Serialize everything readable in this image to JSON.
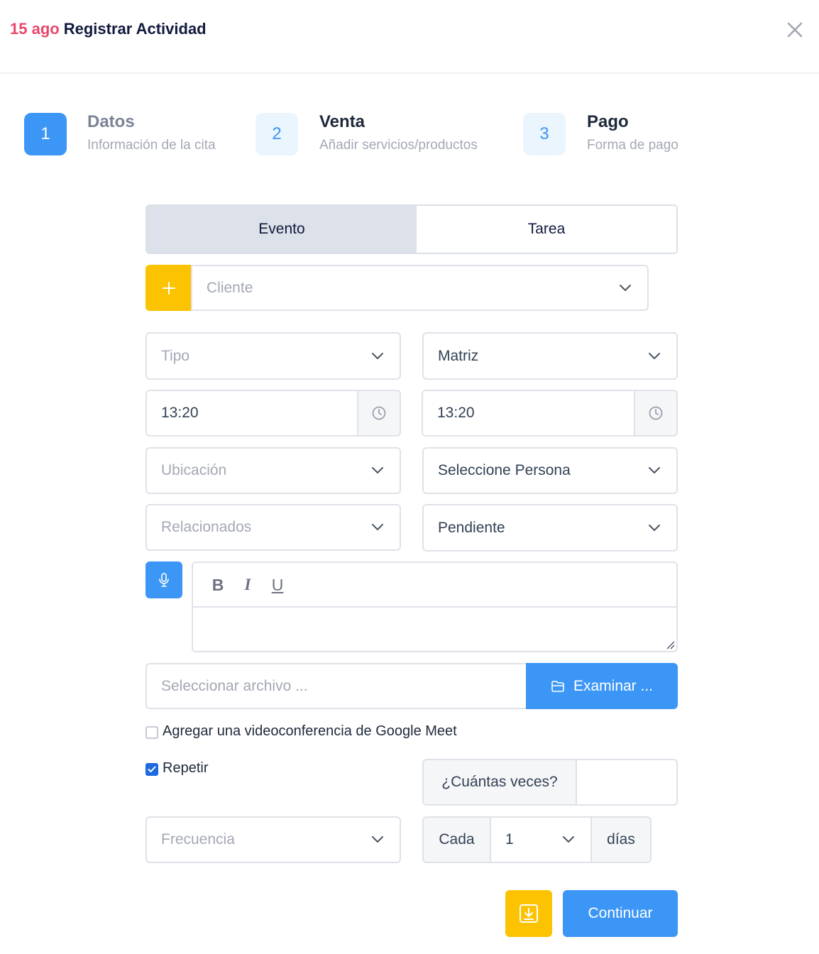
{
  "header": {
    "date": "15 ago",
    "title": "Registrar Actividad",
    "close_icon": "close-icon"
  },
  "steps": [
    {
      "number": "1",
      "title": "Datos",
      "subtitle": "Información de la cita",
      "state": "active"
    },
    {
      "number": "2",
      "title": "Venta",
      "subtitle": "Añadir servicios/productos",
      "state": "pending"
    },
    {
      "number": "3",
      "title": "Pago",
      "subtitle": "Forma de pago",
      "state": "pending"
    }
  ],
  "tabs": {
    "evento": "Evento",
    "tarea": "Tarea",
    "selected": "Evento"
  },
  "client": {
    "placeholder": "Cliente",
    "add_icon": "plus-icon"
  },
  "tipo": {
    "placeholder": "Tipo"
  },
  "matriz": {
    "value": "Matriz"
  },
  "start_time": {
    "value": "13:20",
    "icon": "clock-icon"
  },
  "end_time": {
    "value": "13:20",
    "icon": "clock-icon"
  },
  "ubicacion": {
    "placeholder": "Ubicación"
  },
  "persona": {
    "value": "Seleccione Persona"
  },
  "relacionados": {
    "placeholder": "Relacionados"
  },
  "estado": {
    "value": "Pendiente"
  },
  "editor": {
    "mic_icon": "microphone-icon",
    "bold": "B",
    "italic": "I",
    "underline": "U"
  },
  "file": {
    "placeholder": "Seleccionar archivo ...",
    "browse_label": "Examinar ...",
    "browse_icon": "folder-icon"
  },
  "google_meet": {
    "label": "Agregar una videoconferencia de Google Meet",
    "checked": false
  },
  "repetir": {
    "label": "Repetir",
    "checked": true
  },
  "veces": {
    "label": "¿Cuántas veces?",
    "value": ""
  },
  "frecuencia": {
    "placeholder": "Frecuencia"
  },
  "cada": {
    "prefix": "Cada",
    "value": "1",
    "suffix": "días"
  },
  "footer": {
    "save_icon": "download-save-icon",
    "continue_label": "Continuar"
  },
  "colors": {
    "accent_blue": "#3c96f6",
    "accent_yellow": "#fbc302",
    "date_pink": "#e8476b",
    "checkbox_blue": "#1d6ae0"
  }
}
